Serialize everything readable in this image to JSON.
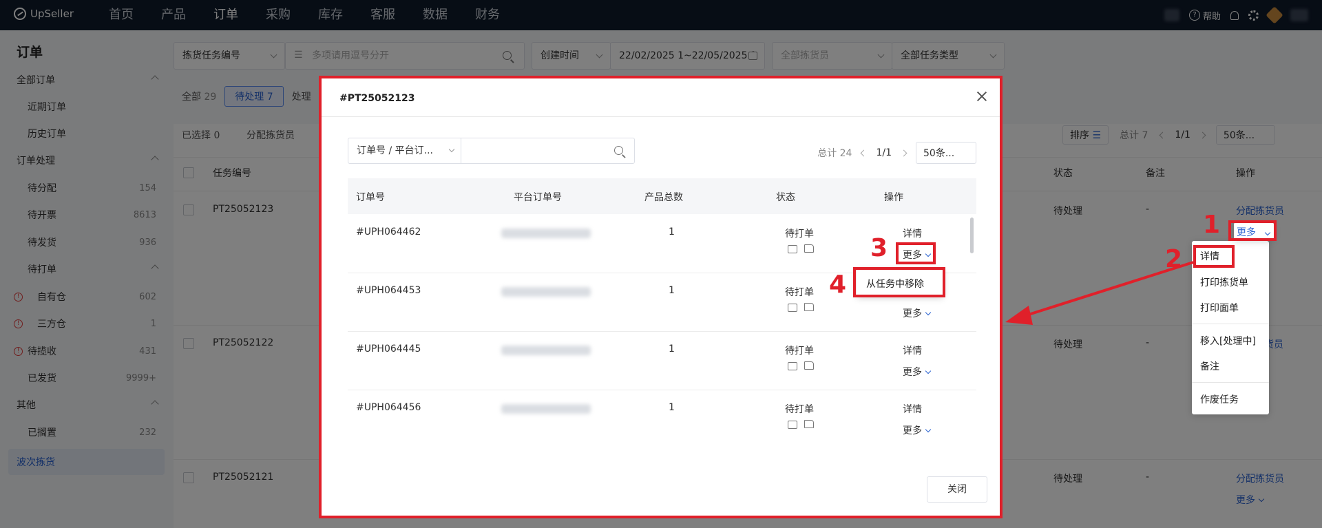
{
  "header": {
    "logo": "UpSeller",
    "nav": [
      "首页",
      "产品",
      "订单",
      "采购",
      "库存",
      "客服",
      "数据",
      "财务"
    ],
    "help": "帮助"
  },
  "sidebar": {
    "title": "订单",
    "groups": [
      {
        "label": "全部订单"
      },
      {
        "label": "近期订单"
      },
      {
        "label": "历史订单"
      },
      {
        "label": "订单处理"
      },
      {
        "label": "待分配",
        "count": "154"
      },
      {
        "label": "待开票",
        "count": "8613"
      },
      {
        "label": "待发货",
        "count": "936"
      },
      {
        "label": "待打单"
      },
      {
        "label": "自有仓",
        "count": "602"
      },
      {
        "label": "三方仓",
        "count": "1"
      },
      {
        "label": "待揽收",
        "count": "431"
      },
      {
        "label": "已发货",
        "count": "9999+"
      },
      {
        "label": "其他"
      },
      {
        "label": "已搁置",
        "count": "232"
      },
      {
        "label": "波次拣货"
      }
    ]
  },
  "filters": {
    "task_no": "拣货任务编号",
    "search_placeholder": "多项请用逗号分开",
    "time_type": "创建时间",
    "date_range": "22/02/2025 1~22/05/2025 1",
    "picker": "全部拣货员",
    "task_type": "全部任务类型"
  },
  "tabs": {
    "all": "全部",
    "all_count": "29",
    "pending": "待处理",
    "pending_count": "7",
    "processing": "处理"
  },
  "toolbar": {
    "selected": "已选择 0",
    "assign": "分配拣货员",
    "sort": "排序",
    "total": "总计 7",
    "page": "1/1",
    "size": "50条..."
  },
  "table": {
    "headers": {
      "task_no": "任务编号",
      "status": "状态",
      "note": "备注",
      "action": "操作"
    },
    "rows": [
      {
        "task_no": "PT25052123",
        "status": "待处理",
        "note": "-",
        "assign": "分配拣货员",
        "more": "更多"
      },
      {
        "task_no": "PT25052122",
        "status": "待处理",
        "note": "-",
        "assign": "货员"
      },
      {
        "task_no": "PT25052121",
        "status": "待处理",
        "note": "-",
        "assign": "分配拣货员",
        "more": "更多"
      }
    ]
  },
  "row_dropdown": {
    "items": [
      "详情",
      "打印拣货单",
      "打印面单",
      "移入[处理中]",
      "备注",
      "作废任务"
    ]
  },
  "modal": {
    "title": "#PT25052123",
    "search_type": "订单号 / 平台订...",
    "total": "总计 24",
    "page": "1/1",
    "size": "50条...",
    "headers": {
      "order_no": "订单号",
      "platform_no": "平台订单号",
      "qty": "产品总数",
      "status": "状态",
      "action": "操作"
    },
    "rows": [
      {
        "order_no": "#UPH064462",
        "qty": "1",
        "status": "待打单",
        "detail": "详情",
        "more": "更多"
      },
      {
        "order_no": "#UPH064453",
        "qty": "1",
        "status": "待打单",
        "detail": "详情",
        "more": "更多"
      },
      {
        "order_no": "#UPH064445",
        "qty": "1",
        "status": "待打单",
        "detail": "详情",
        "more": "更多"
      },
      {
        "order_no": "#UPH064456",
        "qty": "1",
        "status": "待打单",
        "detail": "详情",
        "more": "更多"
      }
    ],
    "remove_item": "从任务中移除",
    "close": "关闭"
  },
  "annotations": {
    "n1": "1",
    "n2": "2",
    "n3": "3",
    "n4": "4",
    "color": "#e0202a"
  }
}
